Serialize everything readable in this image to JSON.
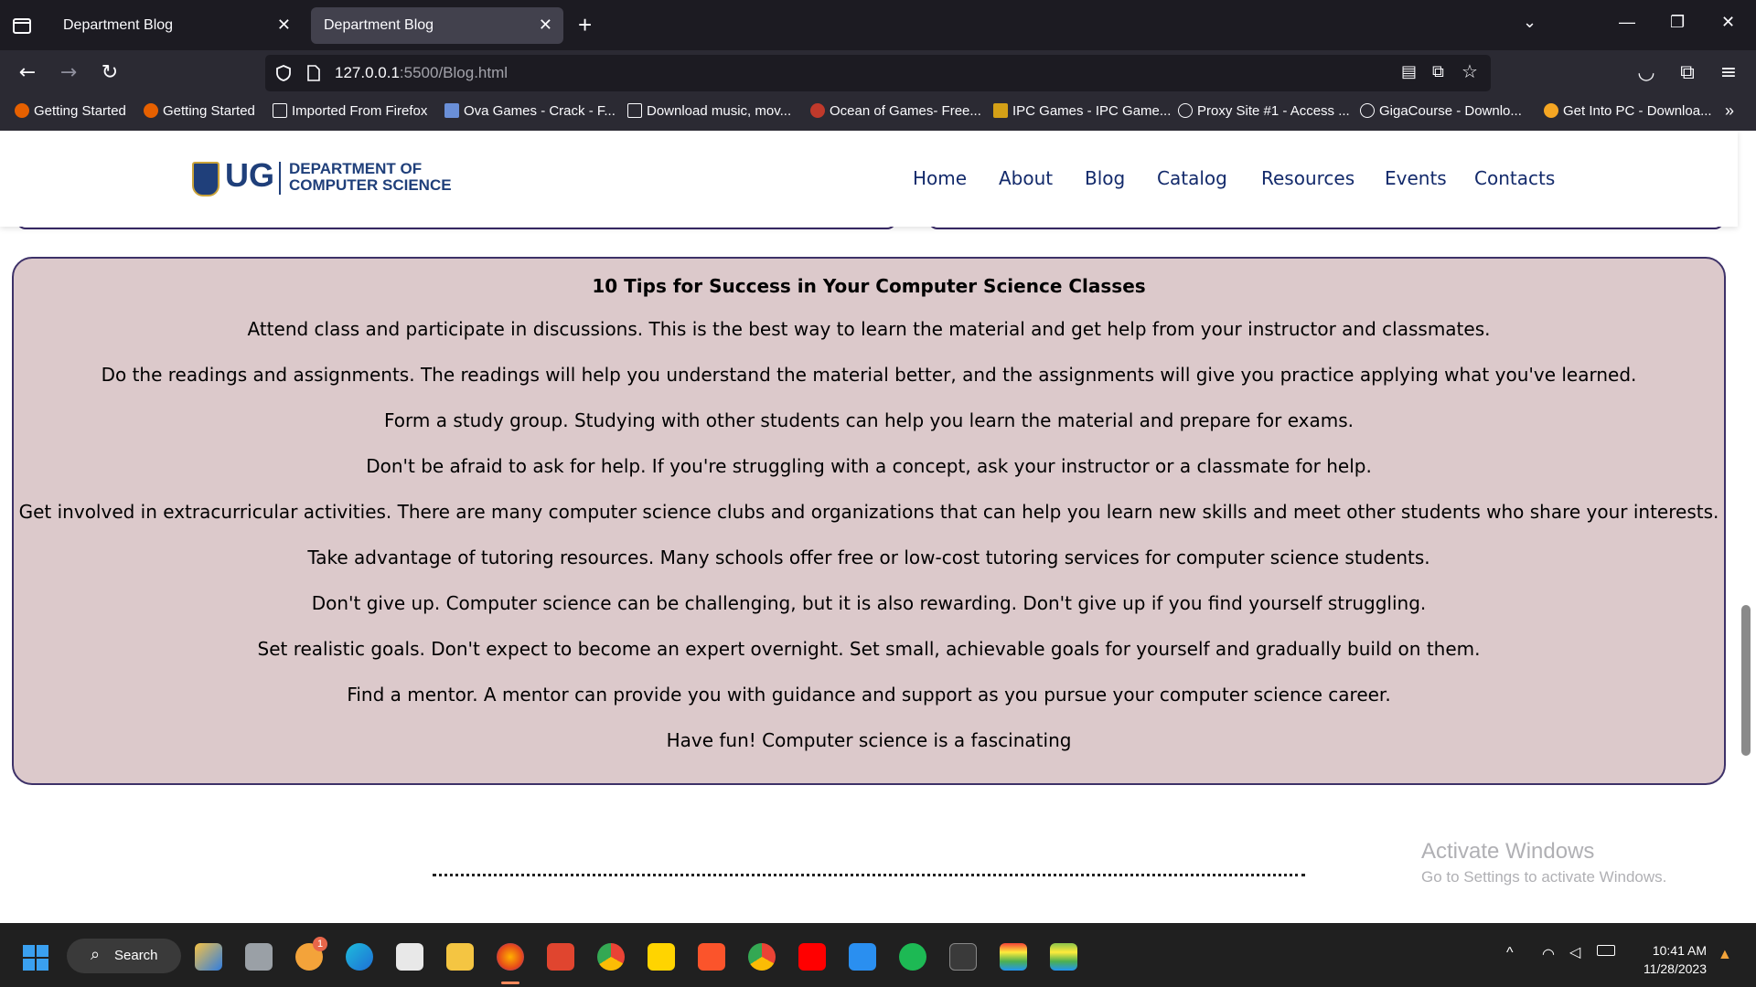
{
  "browser": {
    "tabs": [
      {
        "title": "Department Blog",
        "active": false
      },
      {
        "title": "Department Blog",
        "active": true
      }
    ],
    "url_host": "127.0.0.1",
    "url_rest": ":5500/Blog.html",
    "bookmarks": [
      "Getting Started",
      "Getting Started",
      "Imported From Firefox",
      "Ova Games - Crack - F...",
      "Download music, mov...",
      "Ocean of Games- Free...",
      "IPC Games - IPC Game...",
      "Proxy Site #1 - Access ...",
      "GigaCourse - Downlo...",
      "Get Into PC - Downloa..."
    ]
  },
  "site": {
    "logo_short": "UG",
    "logo_line1": "DEPARTMENT OF",
    "logo_line2": "COMPUTER SCIENCE",
    "nav": [
      "Home",
      "About",
      "Blog",
      "Catalog",
      "Resources",
      "Events",
      "Contacts"
    ]
  },
  "post": {
    "title": "10 Tips for Success in Your Computer Science Classes",
    "tips": [
      "Attend class and participate in discussions. This is the best way to learn the material and get help from your instructor and classmates.",
      "Do the readings and assignments. The readings will help you understand the material better, and the assignments will give you practice applying what you've learned.",
      "Form a study group. Studying with other students can help you learn the material and prepare for exams.",
      "Don't be afraid to ask for help. If you're struggling with a concept, ask your instructor or a classmate for help.",
      "Get involved in extracurricular activities. There are many computer science clubs and organizations that can help you learn new skills and meet other students who share your interests.",
      "Take advantage of tutoring resources. Many schools offer free or low-cost tutoring services for computer science students.",
      "Don't give up. Computer science can be challenging, but it is also rewarding. Don't give up if you find yourself struggling.",
      "Set realistic goals. Don't expect to become an expert overnight. Set small, achievable goals for yourself and gradually build on them.",
      "Find a mentor. A mentor can provide you with guidance and support as you pursue your computer science career.",
      "Have fun! Computer science is a fascinating"
    ]
  },
  "watermark": {
    "line1": "Activate Windows",
    "line2": "Go to Settings to activate Windows."
  },
  "taskbar": {
    "search_label": "Search",
    "time": "10:41 AM",
    "date": "11/28/2023",
    "badge_count": "1"
  }
}
